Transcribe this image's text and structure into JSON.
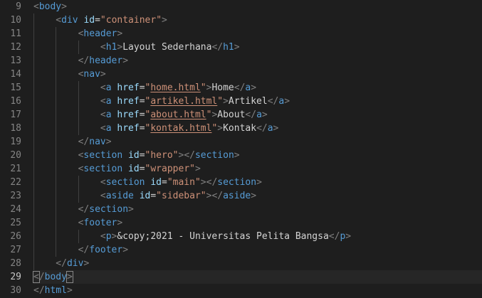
{
  "editor": {
    "language": "html",
    "active_line": 29,
    "colors": {
      "background": "#1e1e1e",
      "line_number": "#858585",
      "punctuation": "#808080",
      "tag": "#569cd6",
      "attribute": "#9cdcfe",
      "string": "#ce9178",
      "text": "#d4d4d4"
    },
    "lines": [
      {
        "num": "9",
        "indent": 0,
        "tokens": [
          [
            "punc",
            "<"
          ],
          [
            "tag",
            "body"
          ],
          [
            "punc",
            ">"
          ]
        ]
      },
      {
        "num": "10",
        "indent": 1,
        "tokens": [
          [
            "punc",
            "<"
          ],
          [
            "tag",
            "div"
          ],
          [
            "txt",
            " "
          ],
          [
            "attr",
            "id"
          ],
          [
            "eq",
            "="
          ],
          [
            "str",
            "\"container\""
          ],
          [
            "punc",
            ">"
          ]
        ]
      },
      {
        "num": "11",
        "indent": 2,
        "tokens": [
          [
            "punc",
            "<"
          ],
          [
            "tag",
            "header"
          ],
          [
            "punc",
            ">"
          ]
        ]
      },
      {
        "num": "12",
        "indent": 3,
        "tokens": [
          [
            "punc",
            "<"
          ],
          [
            "tag",
            "h1"
          ],
          [
            "punc",
            ">"
          ],
          [
            "txt",
            "Layout Sederhana"
          ],
          [
            "punc",
            "</"
          ],
          [
            "tag",
            "h1"
          ],
          [
            "punc",
            ">"
          ]
        ]
      },
      {
        "num": "13",
        "indent": 2,
        "tokens": [
          [
            "punc",
            "</"
          ],
          [
            "tag",
            "header"
          ],
          [
            "punc",
            ">"
          ]
        ]
      },
      {
        "num": "14",
        "indent": 2,
        "tokens": [
          [
            "punc",
            "<"
          ],
          [
            "tag",
            "nav"
          ],
          [
            "punc",
            ">"
          ]
        ]
      },
      {
        "num": "15",
        "indent": 3,
        "tokens": [
          [
            "punc",
            "<"
          ],
          [
            "tag",
            "a"
          ],
          [
            "txt",
            " "
          ],
          [
            "attr",
            "href"
          ],
          [
            "eq",
            "="
          ],
          [
            "str",
            "\""
          ],
          [
            "link",
            "home.html"
          ],
          [
            "str",
            "\""
          ],
          [
            "punc",
            ">"
          ],
          [
            "txt",
            "Home"
          ],
          [
            "punc",
            "</"
          ],
          [
            "tag",
            "a"
          ],
          [
            "punc",
            ">"
          ]
        ]
      },
      {
        "num": "16",
        "indent": 3,
        "tokens": [
          [
            "punc",
            "<"
          ],
          [
            "tag",
            "a"
          ],
          [
            "txt",
            " "
          ],
          [
            "attr",
            "href"
          ],
          [
            "eq",
            "="
          ],
          [
            "str",
            "\""
          ],
          [
            "link",
            "artikel.html"
          ],
          [
            "str",
            "\""
          ],
          [
            "punc",
            ">"
          ],
          [
            "txt",
            "Artikel"
          ],
          [
            "punc",
            "</"
          ],
          [
            "tag",
            "a"
          ],
          [
            "punc",
            ">"
          ]
        ]
      },
      {
        "num": "17",
        "indent": 3,
        "tokens": [
          [
            "punc",
            "<"
          ],
          [
            "tag",
            "a"
          ],
          [
            "txt",
            " "
          ],
          [
            "attr",
            "href"
          ],
          [
            "eq",
            "="
          ],
          [
            "str",
            "\""
          ],
          [
            "link",
            "about.html"
          ],
          [
            "str",
            "\""
          ],
          [
            "punc",
            ">"
          ],
          [
            "txt",
            "About"
          ],
          [
            "punc",
            "</"
          ],
          [
            "tag",
            "a"
          ],
          [
            "punc",
            ">"
          ]
        ]
      },
      {
        "num": "18",
        "indent": 3,
        "tokens": [
          [
            "punc",
            "<"
          ],
          [
            "tag",
            "a"
          ],
          [
            "txt",
            " "
          ],
          [
            "attr",
            "href"
          ],
          [
            "eq",
            "="
          ],
          [
            "str",
            "\""
          ],
          [
            "link",
            "kontak.html"
          ],
          [
            "str",
            "\""
          ],
          [
            "punc",
            ">"
          ],
          [
            "txt",
            "Kontak"
          ],
          [
            "punc",
            "</"
          ],
          [
            "tag",
            "a"
          ],
          [
            "punc",
            ">"
          ]
        ]
      },
      {
        "num": "19",
        "indent": 2,
        "tokens": [
          [
            "punc",
            "</"
          ],
          [
            "tag",
            "nav"
          ],
          [
            "punc",
            ">"
          ]
        ]
      },
      {
        "num": "20",
        "indent": 2,
        "tokens": [
          [
            "punc",
            "<"
          ],
          [
            "tag",
            "section"
          ],
          [
            "txt",
            " "
          ],
          [
            "attr",
            "id"
          ],
          [
            "eq",
            "="
          ],
          [
            "str",
            "\"hero\""
          ],
          [
            "punc",
            "></"
          ],
          [
            "tag",
            "section"
          ],
          [
            "punc",
            ">"
          ]
        ]
      },
      {
        "num": "21",
        "indent": 2,
        "tokens": [
          [
            "punc",
            "<"
          ],
          [
            "tag",
            "section"
          ],
          [
            "txt",
            " "
          ],
          [
            "attr",
            "id"
          ],
          [
            "eq",
            "="
          ],
          [
            "str",
            "\"wrapper\""
          ],
          [
            "punc",
            ">"
          ]
        ]
      },
      {
        "num": "22",
        "indent": 3,
        "tokens": [
          [
            "punc",
            "<"
          ],
          [
            "tag",
            "section"
          ],
          [
            "txt",
            " "
          ],
          [
            "attr",
            "id"
          ],
          [
            "eq",
            "="
          ],
          [
            "str",
            "\"main\""
          ],
          [
            "punc",
            "></"
          ],
          [
            "tag",
            "section"
          ],
          [
            "punc",
            ">"
          ]
        ]
      },
      {
        "num": "23",
        "indent": 3,
        "tokens": [
          [
            "punc",
            "<"
          ],
          [
            "tag",
            "aside"
          ],
          [
            "txt",
            " "
          ],
          [
            "attr",
            "id"
          ],
          [
            "eq",
            "="
          ],
          [
            "str",
            "\"sidebar\""
          ],
          [
            "punc",
            "></"
          ],
          [
            "tag",
            "aside"
          ],
          [
            "punc",
            ">"
          ]
        ]
      },
      {
        "num": "24",
        "indent": 2,
        "tokens": [
          [
            "punc",
            "</"
          ],
          [
            "tag",
            "section"
          ],
          [
            "punc",
            ">"
          ]
        ]
      },
      {
        "num": "25",
        "indent": 2,
        "tokens": [
          [
            "punc",
            "<"
          ],
          [
            "tag",
            "footer"
          ],
          [
            "punc",
            ">"
          ]
        ]
      },
      {
        "num": "26",
        "indent": 3,
        "tokens": [
          [
            "punc",
            "<"
          ],
          [
            "tag",
            "p"
          ],
          [
            "punc",
            ">"
          ],
          [
            "txt",
            "&copy;2021 - Universitas Pelita Bangsa"
          ],
          [
            "punc",
            "</"
          ],
          [
            "tag",
            "p"
          ],
          [
            "punc",
            ">"
          ]
        ]
      },
      {
        "num": "27",
        "indent": 2,
        "tokens": [
          [
            "punc",
            "</"
          ],
          [
            "tag",
            "footer"
          ],
          [
            "punc",
            ">"
          ]
        ]
      },
      {
        "num": "28",
        "indent": 1,
        "tokens": [
          [
            "punc",
            "</"
          ],
          [
            "tag",
            "div"
          ],
          [
            "punc",
            ">"
          ]
        ]
      },
      {
        "num": "29",
        "indent": 0,
        "tokens": [
          [
            "box",
            "<"
          ],
          [
            "punc",
            "/"
          ],
          [
            "tag",
            "body"
          ],
          [
            "box",
            ">"
          ]
        ]
      },
      {
        "num": "30",
        "indent": 0,
        "tokens": [
          [
            "punc",
            "</"
          ],
          [
            "tag",
            "html"
          ],
          [
            "punc",
            ">"
          ]
        ]
      }
    ]
  }
}
